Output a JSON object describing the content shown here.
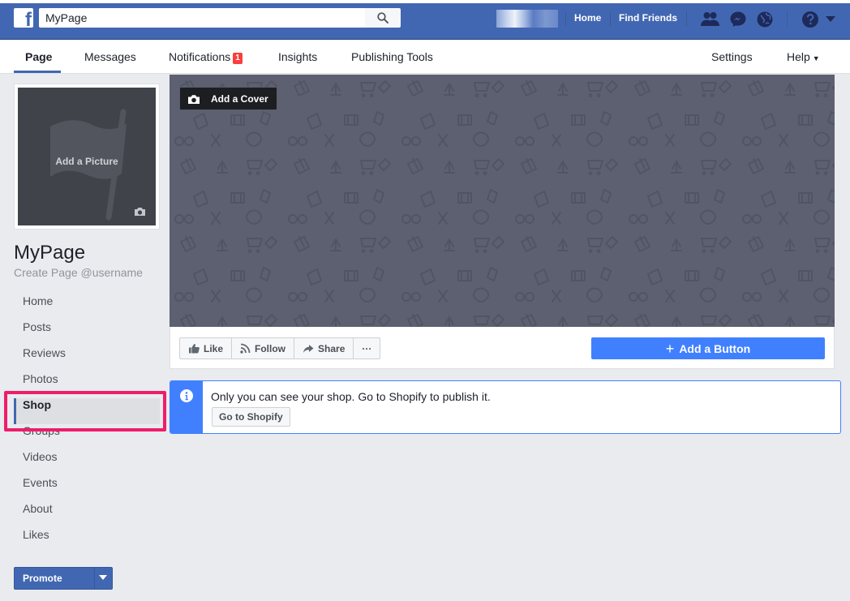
{
  "topbar": {
    "search_value": "MyPage",
    "links": {
      "home": "Home",
      "find_friends": "Find Friends"
    },
    "colors": {
      "bar": "#4267b2",
      "accent": "#4080ff",
      "highlight": "#ee1d6b"
    }
  },
  "tabs": [
    {
      "label": "Page",
      "active": true
    },
    {
      "label": "Messages"
    },
    {
      "label": "Notifications",
      "badge": "1"
    },
    {
      "label": "Insights"
    },
    {
      "label": "Publishing Tools"
    },
    {
      "label": "Settings"
    },
    {
      "label": "Help"
    }
  ],
  "profile": {
    "add_picture": "Add a Picture",
    "name": "MyPage",
    "username_prompt": "Create Page @username"
  },
  "sidebar": {
    "items": [
      {
        "label": "Home"
      },
      {
        "label": "Posts"
      },
      {
        "label": "Reviews"
      },
      {
        "label": "Photos"
      },
      {
        "label": "Shop",
        "active": true
      },
      {
        "label": "Groups"
      },
      {
        "label": "Videos"
      },
      {
        "label": "Events"
      },
      {
        "label": "About"
      },
      {
        "label": "Likes"
      }
    ],
    "promote": "Promote"
  },
  "cover": {
    "add_cover": "Add a Cover"
  },
  "actions": {
    "like": "Like",
    "follow": "Follow",
    "share": "Share",
    "more": "···",
    "add_button": "Add a Button"
  },
  "notice": {
    "text": "Only you can see your shop. Go to Shopify to publish it.",
    "button": "Go to Shopify"
  }
}
